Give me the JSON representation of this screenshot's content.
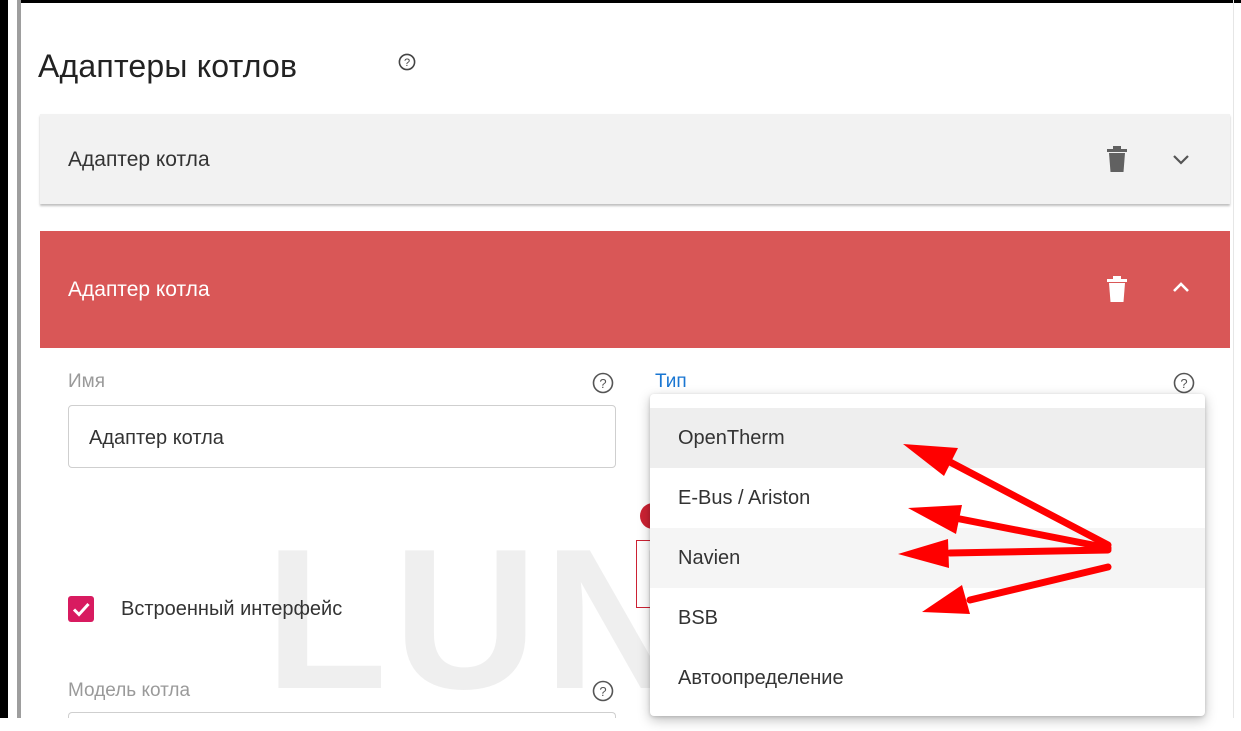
{
  "page": {
    "title": "Адаптеры котлов"
  },
  "panels": [
    {
      "title": "Адаптер котла",
      "state": "collapsed"
    },
    {
      "title": "Адаптер котла",
      "state": "expanded"
    }
  ],
  "form": {
    "name_label": "Имя",
    "name_value": "Адаптер котла",
    "type_label": "Тип",
    "checkbox_label": "Встроенный интерфейс",
    "checkbox_checked": true,
    "model_label": "Модель котла"
  },
  "dropdown": {
    "options": [
      "OpenTherm",
      "E-Bus / Ariston",
      "Navien",
      "BSB",
      "Автоопределение"
    ],
    "highlighted": "OpenTherm"
  },
  "watermark": {
    "text": "LUNDA"
  },
  "colors": {
    "accent_red": "#d95757",
    "link_blue": "#1976d2",
    "checkbox_pink": "#d81b60",
    "arrow_red": "#ff0000"
  },
  "icons": [
    "help-icon",
    "trash-icon",
    "chevron-down-icon",
    "chevron-up-icon",
    "check-icon",
    "arrow-annotation"
  ]
}
